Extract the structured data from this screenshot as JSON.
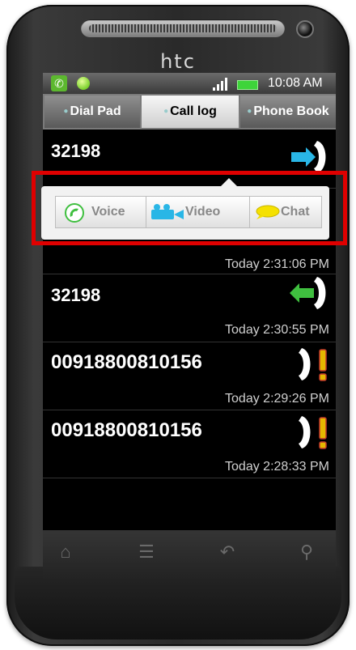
{
  "device": {
    "brand": "htc"
  },
  "status_bar": {
    "time": "10:08 AM"
  },
  "tabs": [
    {
      "label": "Dial Pad"
    },
    {
      "label": "Call log"
    },
    {
      "label": "Phone Book"
    }
  ],
  "call_log": [
    {
      "number": "32198",
      "timestamp": "",
      "icon": "outgoing-call-icon"
    },
    {
      "number": "",
      "timestamp": "Today 2:31:06 PM",
      "icon": "missed-call-icon"
    },
    {
      "number": "32198",
      "timestamp": "Today 2:30:55 PM",
      "icon": "incoming-call-icon"
    },
    {
      "number": "00918800810156",
      "timestamp": "Today 2:29:26 PM",
      "icon": "missed-call-icon"
    },
    {
      "number": "00918800810156",
      "timestamp": "Today 2:28:33 PM",
      "icon": "missed-call-icon"
    }
  ],
  "popup": {
    "voice_label": "Voice",
    "video_label": "Video",
    "chat_label": "Chat"
  },
  "colors": {
    "highlight": "#e00000",
    "outgoing_arrow": "#29b6e6",
    "incoming_arrow": "#3fbf3f",
    "missed_mark": "#e5b800"
  },
  "nav": [
    {
      "icon": "home-icon"
    },
    {
      "icon": "menu-icon"
    },
    {
      "icon": "back-icon"
    },
    {
      "icon": "search-icon"
    }
  ]
}
